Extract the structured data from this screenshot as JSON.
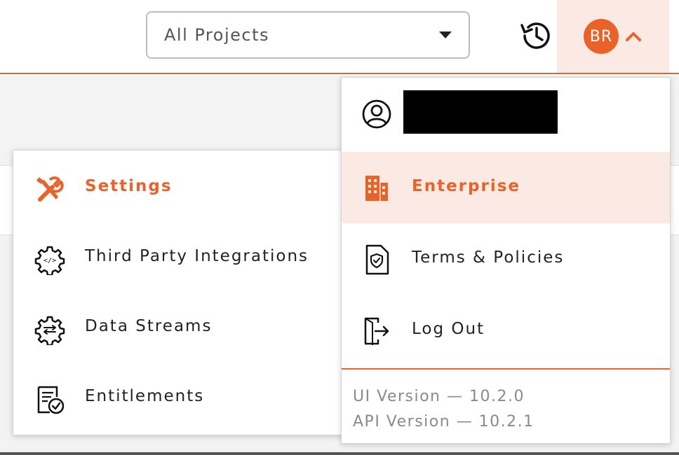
{
  "header": {
    "project_selector": {
      "selected": "All Projects"
    },
    "user": {
      "initials": "BR"
    }
  },
  "settings_menu": {
    "items": [
      {
        "label": "Settings",
        "icon": "tools-icon",
        "active": true
      },
      {
        "label": "Third Party Integrations",
        "icon": "code-gear-icon",
        "active": false
      },
      {
        "label": "Data Streams",
        "icon": "stream-gear-icon",
        "active": false
      },
      {
        "label": "Entitlements",
        "icon": "certificate-icon",
        "active": false
      }
    ]
  },
  "user_menu": {
    "profile_icon": "user-circle-icon",
    "items": [
      {
        "label": "Enterprise",
        "icon": "building-icon",
        "active": true
      },
      {
        "label": "Terms & Policies",
        "icon": "shield-document-icon",
        "active": false
      },
      {
        "label": "Log Out",
        "icon": "logout-icon",
        "active": false
      }
    ],
    "ui_version": "UI Version — 10.2.0",
    "api_version": "API Version — 10.2.1"
  },
  "colors": {
    "accent": "#e8622a",
    "accent_light": "#fbeae3",
    "muted_text": "#8a8a8a"
  }
}
